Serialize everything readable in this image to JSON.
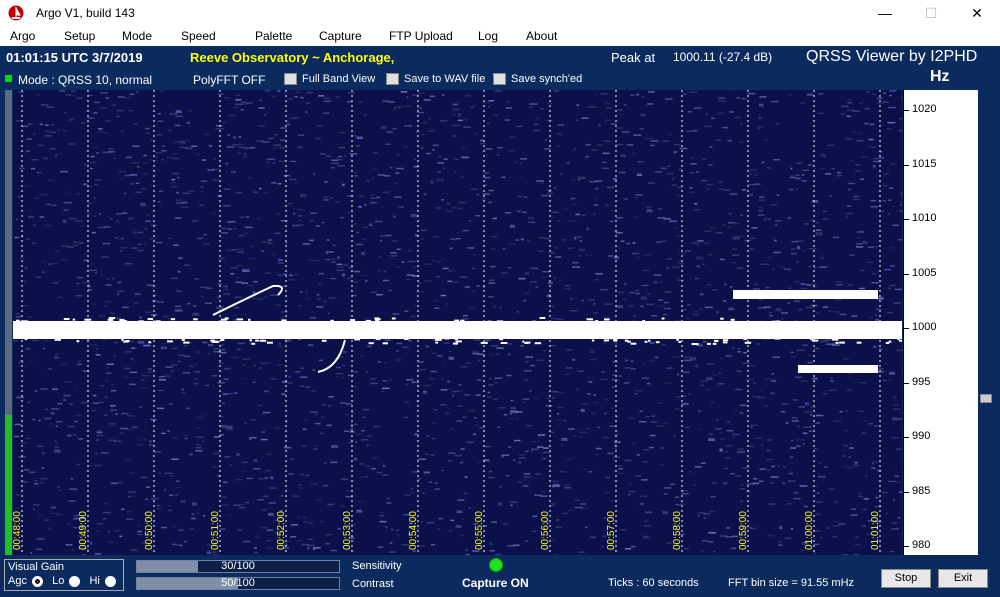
{
  "window": {
    "title": "Argo V1, build 143",
    "minimize": "—",
    "maximize": "☐",
    "close": "✕"
  },
  "menu": [
    "Argo",
    "Setup",
    "Mode",
    "Speed",
    "Palette",
    "Capture",
    "FTP Upload",
    "Log",
    "About"
  ],
  "header": {
    "utc": "01:01:15 UTC  3/7/2019",
    "observatory": "Reeve Observatory ~ Anchorage,",
    "peak_label": "Peak at",
    "peak_value": "1000.11 (-27.4 dB)",
    "brand": "QRSS Viewer by I2PHD",
    "unit": "Hz"
  },
  "options": {
    "mode": "Mode : QRSS 10, normal",
    "polyfft": "PolyFFT OFF",
    "full_band": "Full Band View",
    "save_wav": "Save to WAV file",
    "save_synched": "Save synch'ed"
  },
  "freq_ticks": [
    "1020",
    "1015",
    "1010",
    "1005",
    "1000",
    "995",
    "990",
    "985",
    "980"
  ],
  "time_ticks": [
    "00:48:00",
    "00:49:00",
    "00:50:00",
    "00:51:00",
    "00:52:00",
    "00:53:00",
    "00:54:00",
    "00:55:00",
    "00:56:00",
    "00:57:00",
    "00:58:00",
    "00:59:00",
    "01:00:00",
    "01:01:00"
  ],
  "bottom": {
    "visual_gain": "Visual Gain",
    "agc": "Agc",
    "lo": "Lo",
    "hi": "Hi",
    "sensitivity_value": "30/100",
    "sensitivity_level": 0.3,
    "sensitivity_label": "Sensitivity",
    "contrast_value": "50/100",
    "contrast_level": 0.5,
    "contrast_label": "Contrast",
    "capture": "Capture ON",
    "ticks": "Ticks  : 60 seconds",
    "bin_size": "FFT bin size = 91.55 mHz",
    "stop": "Stop",
    "exit": "Exit"
  }
}
